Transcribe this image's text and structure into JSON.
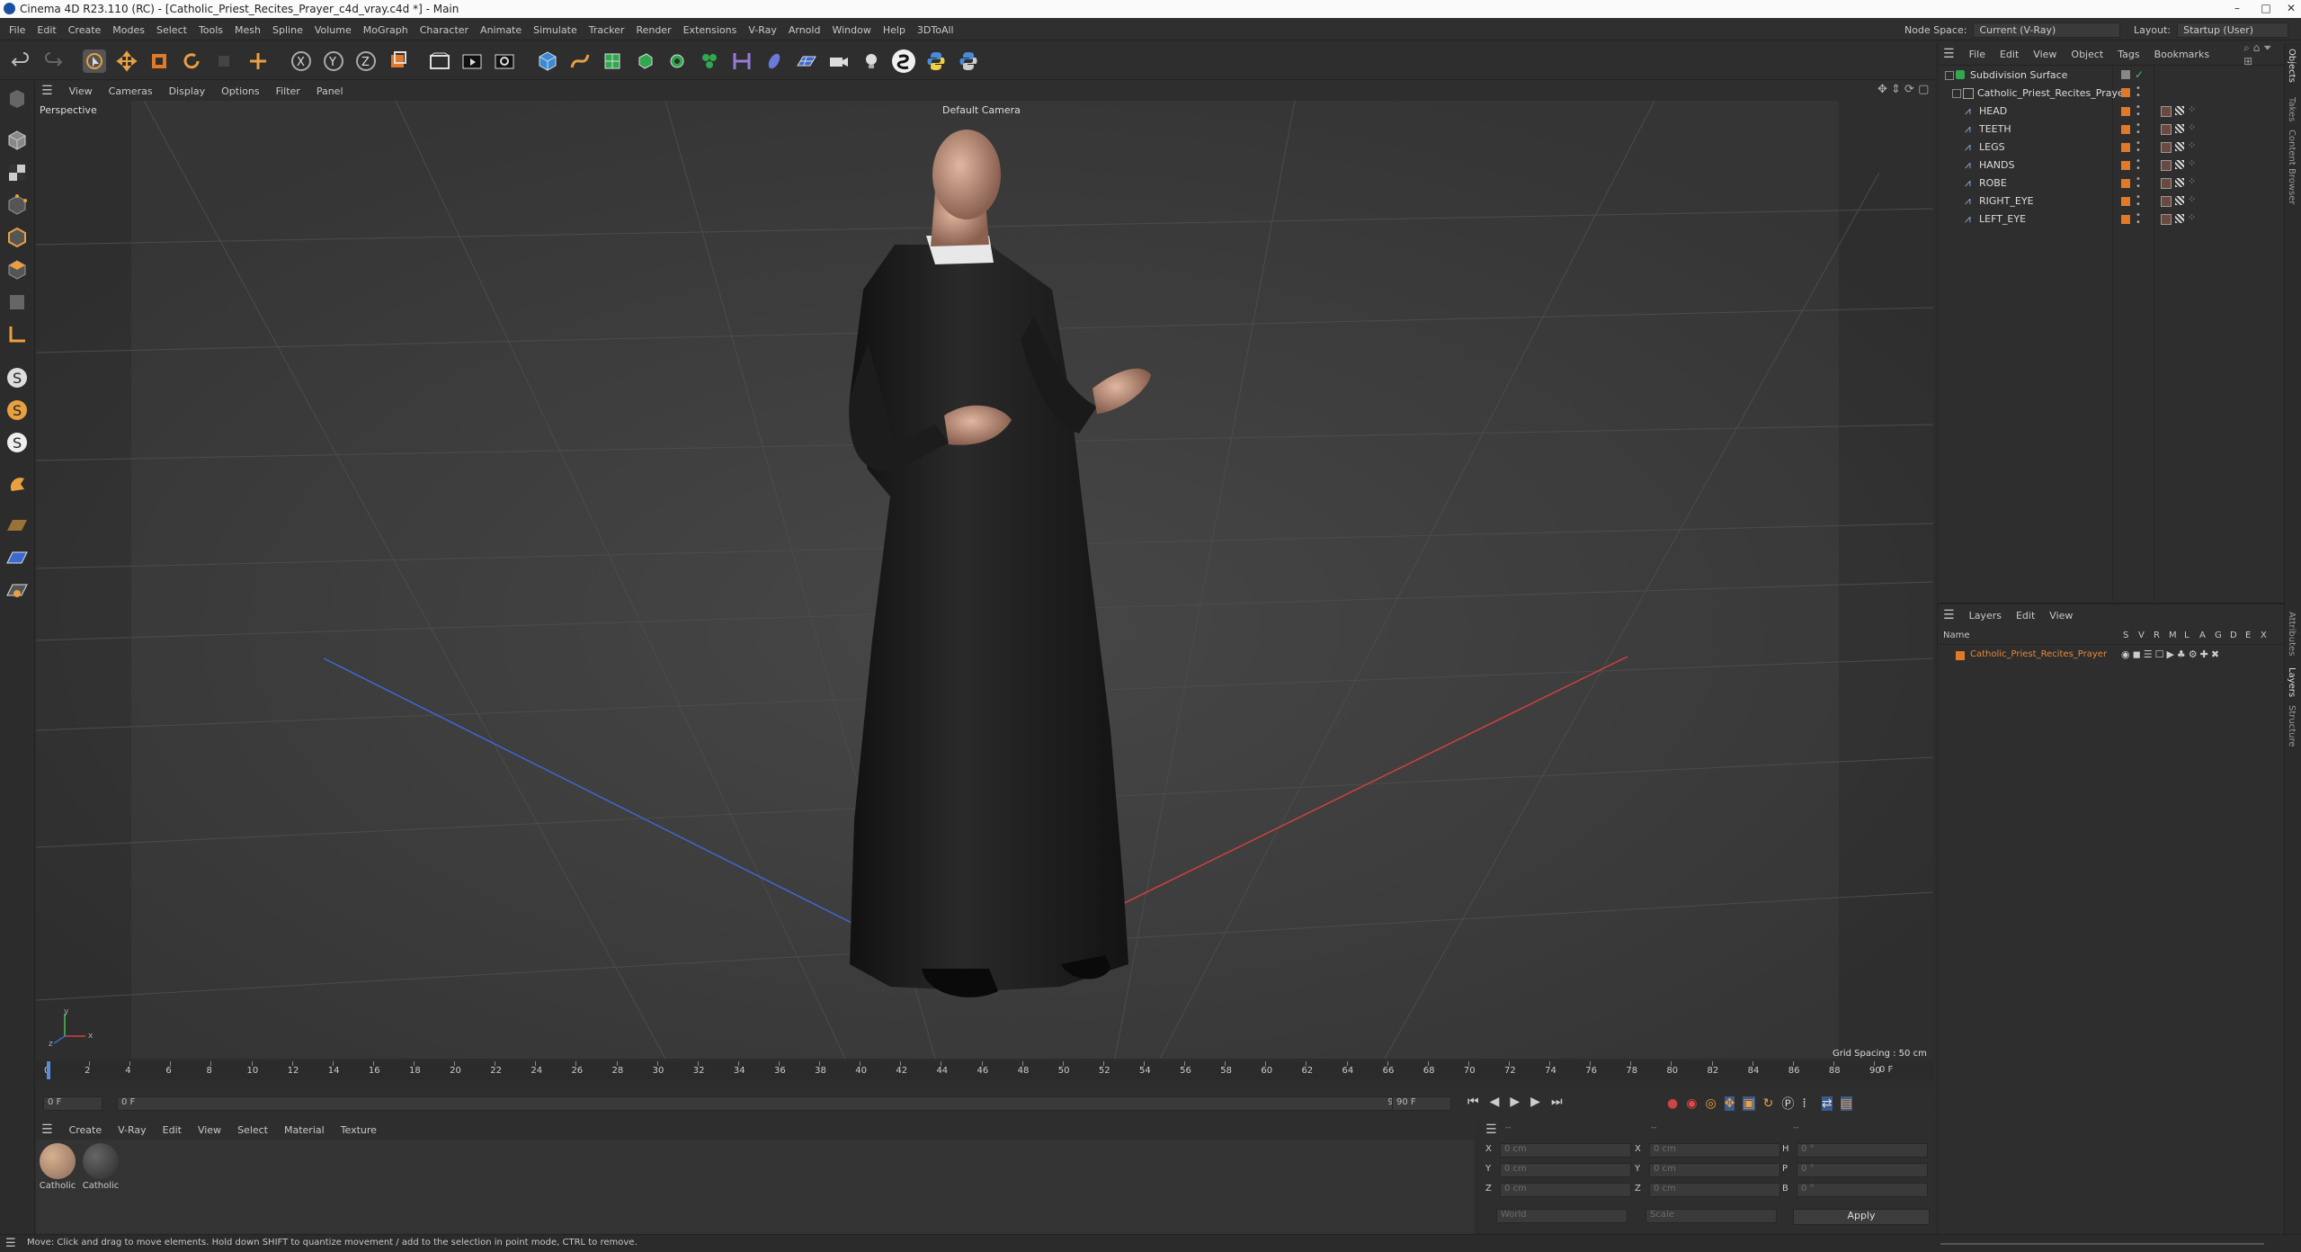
{
  "window": {
    "title": "Cinema 4D R23.110 (RC) - [Catholic_Priest_Recites_Prayer_c4d_vray.c4d *] - Main",
    "controls": [
      "–",
      "□",
      "✕"
    ]
  },
  "menubar": {
    "items": [
      "File",
      "Edit",
      "Create",
      "Modes",
      "Select",
      "Tools",
      "Mesh",
      "Spline",
      "Volume",
      "MoGraph",
      "Character",
      "Animate",
      "Simulate",
      "Tracker",
      "Render",
      "Extensions",
      "V-Ray",
      "Arnold",
      "Window",
      "Help",
      "3DToAll"
    ],
    "node_space_label": "Node Space:",
    "node_space_value": "Current (V-Ray)",
    "layout_label": "Layout:",
    "layout_value": "Startup (User)"
  },
  "viewport": {
    "menu": [
      "View",
      "Cameras",
      "Display",
      "Options",
      "Filter",
      "Panel"
    ],
    "label": "Perspective",
    "camera": "Default Camera",
    "grid_spacing": "Grid Spacing : 50 cm",
    "axis_labels": [
      "y",
      "z",
      "x"
    ]
  },
  "timeline": {
    "ticks": [
      "0",
      "2",
      "4",
      "6",
      "8",
      "10",
      "12",
      "14",
      "16",
      "18",
      "20",
      "22",
      "24",
      "26",
      "28",
      "30",
      "32",
      "34",
      "36",
      "38",
      "40",
      "42",
      "44",
      "46",
      "48",
      "50",
      "52",
      "54",
      "56",
      "58",
      "60",
      "62",
      "64",
      "66",
      "68",
      "70",
      "72",
      "74",
      "76",
      "78",
      "80",
      "82",
      "84",
      "86",
      "88",
      "90"
    ],
    "current_frame_right": "0 F",
    "start_field": "0 F",
    "start_field2": "0 F",
    "end_field": "90 F",
    "end_field2": "90 F"
  },
  "material_manager": {
    "menu": [
      "Create",
      "V-Ray",
      "Edit",
      "View",
      "Select",
      "Material",
      "Texture"
    ],
    "materials": [
      {
        "name": "Catholic",
        "color": "#8a6a58"
      },
      {
        "name": "Catholic",
        "color": "#2a2a2a"
      }
    ]
  },
  "coordinates": {
    "header_dash1": "--",
    "header_dash2": "--",
    "header_dash3": "--",
    "rows": [
      {
        "a": "X",
        "av": "0 cm",
        "b": "X",
        "bv": "0 cm",
        "c": "H",
        "cv": "0 °"
      },
      {
        "a": "Y",
        "av": "0 cm",
        "b": "Y",
        "bv": "0 cm",
        "c": "P",
        "cv": "0 °"
      },
      {
        "a": "Z",
        "av": "0 cm",
        "b": "Z",
        "bv": "0 cm",
        "c": "B",
        "cv": "0 °"
      }
    ],
    "space": "World",
    "mode": "Scale",
    "apply": "Apply"
  },
  "object_manager": {
    "menu": [
      "File",
      "Edit",
      "View",
      "Object",
      "Tags",
      "Bookmarks"
    ],
    "root": "Subdivision Surface",
    "group": "Catholic_Priest_Recites_Prayer",
    "children": [
      "HEAD",
      "TEETH",
      "LEGS",
      "HANDS",
      "ROBE",
      "RIGHT_EYE",
      "LEFT_EYE"
    ]
  },
  "layer_manager": {
    "menu": [
      "Layers",
      "Edit",
      "View"
    ],
    "name_col": "Name",
    "cols": [
      "S",
      "V",
      "R",
      "M",
      "L",
      "A",
      "G",
      "D",
      "E",
      "X"
    ],
    "layer": "Catholic_Priest_Recites_Prayer",
    "layer_color": "#e07a2a"
  },
  "side_tabs": [
    "Objects",
    "Takes",
    "Content Browser",
    "Attributes",
    "Layers",
    "Structure"
  ],
  "status": "Move: Click and drag to move elements. Hold down SHIFT to quantize movement / add to the selection in point mode, CTRL to remove.",
  "colors": {
    "accent": "#e07a2a",
    "axis_x": "#d04040",
    "axis_z": "#3a6ad0",
    "axis_y": "#40c060"
  }
}
